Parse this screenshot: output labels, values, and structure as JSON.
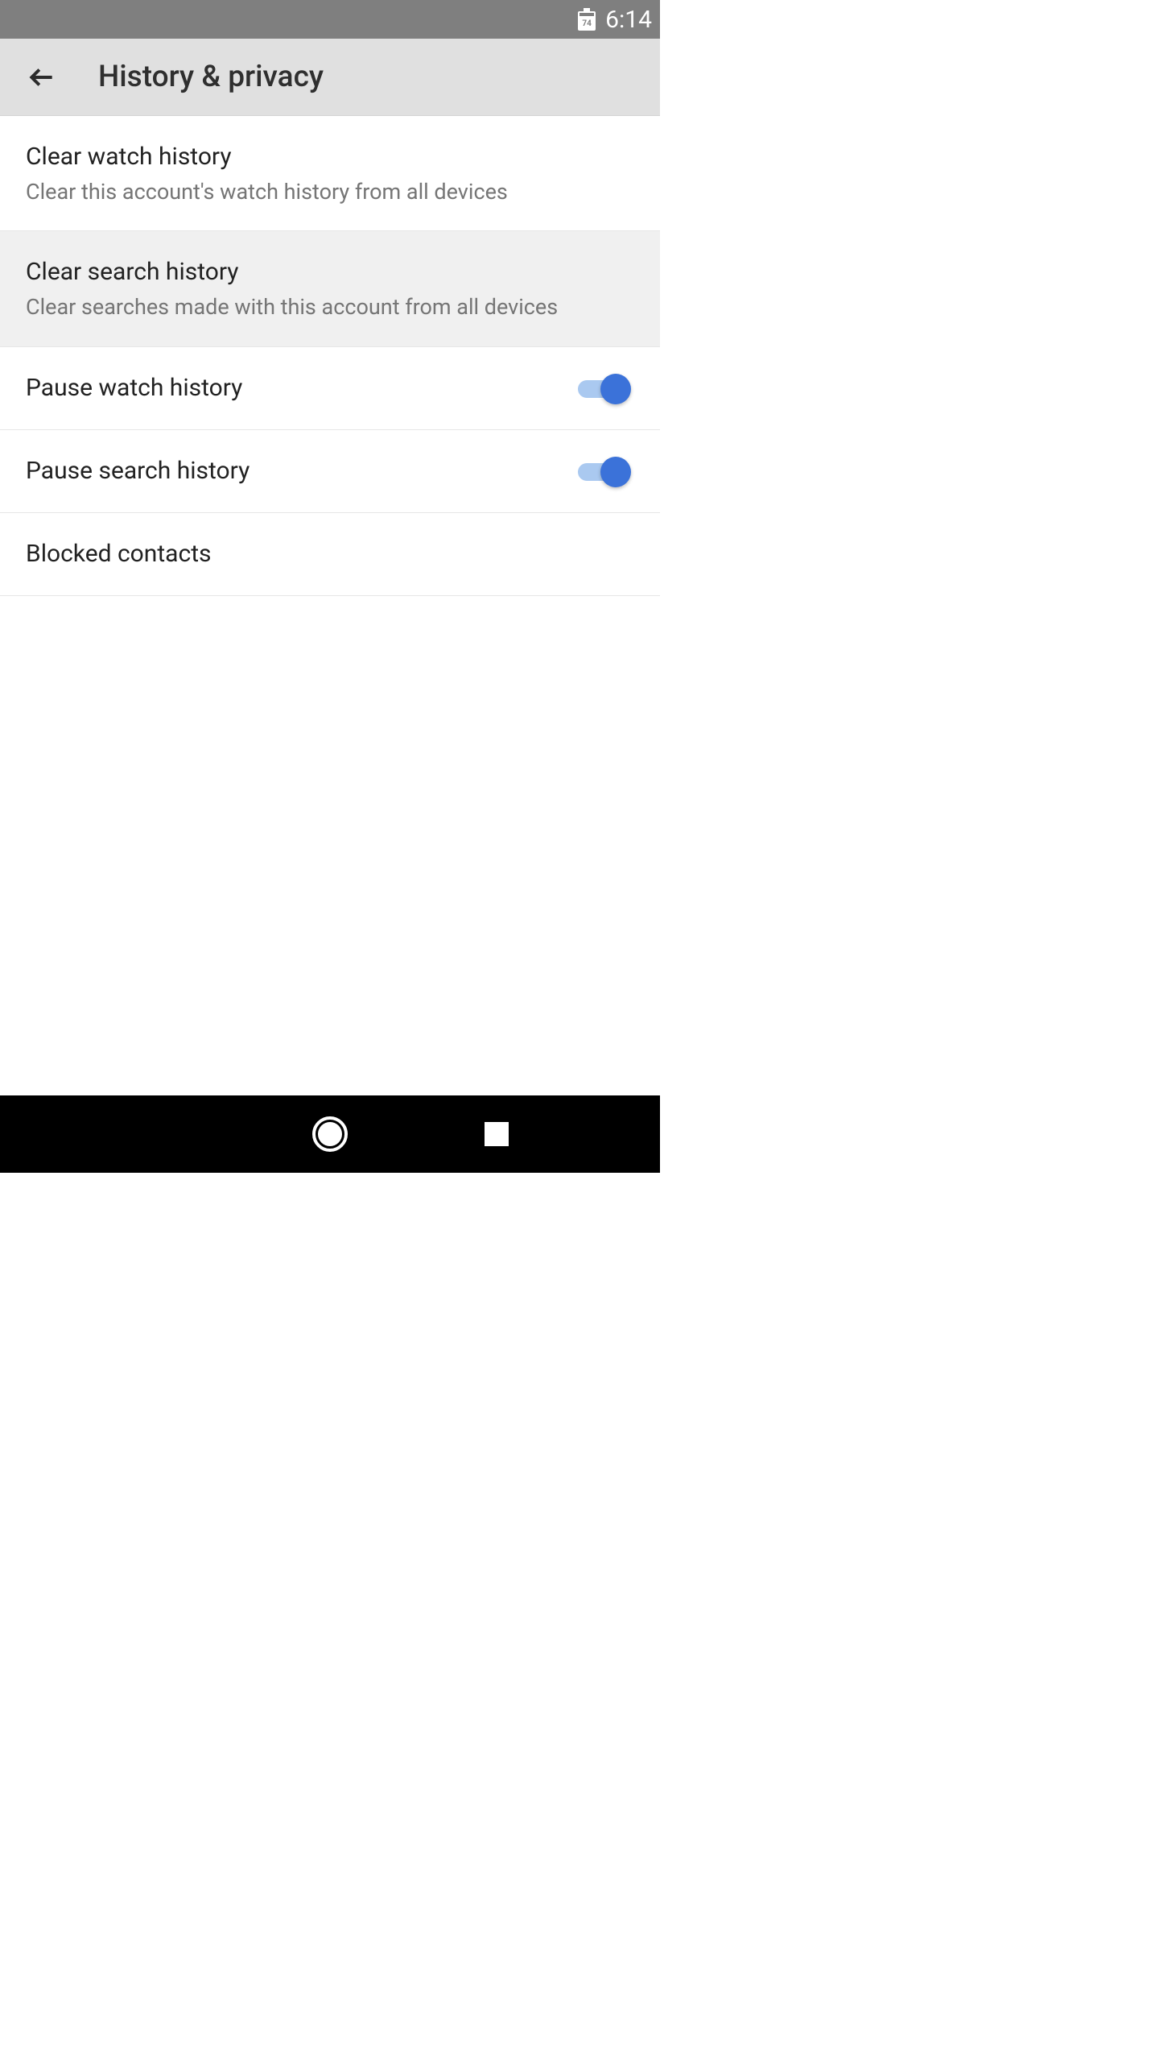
{
  "status": {
    "battery_level": "74",
    "time": "6:14"
  },
  "header": {
    "title": "History & privacy"
  },
  "settings": {
    "clear_watch": {
      "title": "Clear watch history",
      "subtitle": "Clear this account's watch history from all devices"
    },
    "clear_search": {
      "title": "Clear search history",
      "subtitle": "Clear searches made with this account from all devices"
    },
    "pause_watch": {
      "title": "Pause watch history",
      "enabled": true
    },
    "pause_search": {
      "title": "Pause search history",
      "enabled": true
    },
    "blocked_contacts": {
      "title": "Blocked contacts"
    }
  }
}
